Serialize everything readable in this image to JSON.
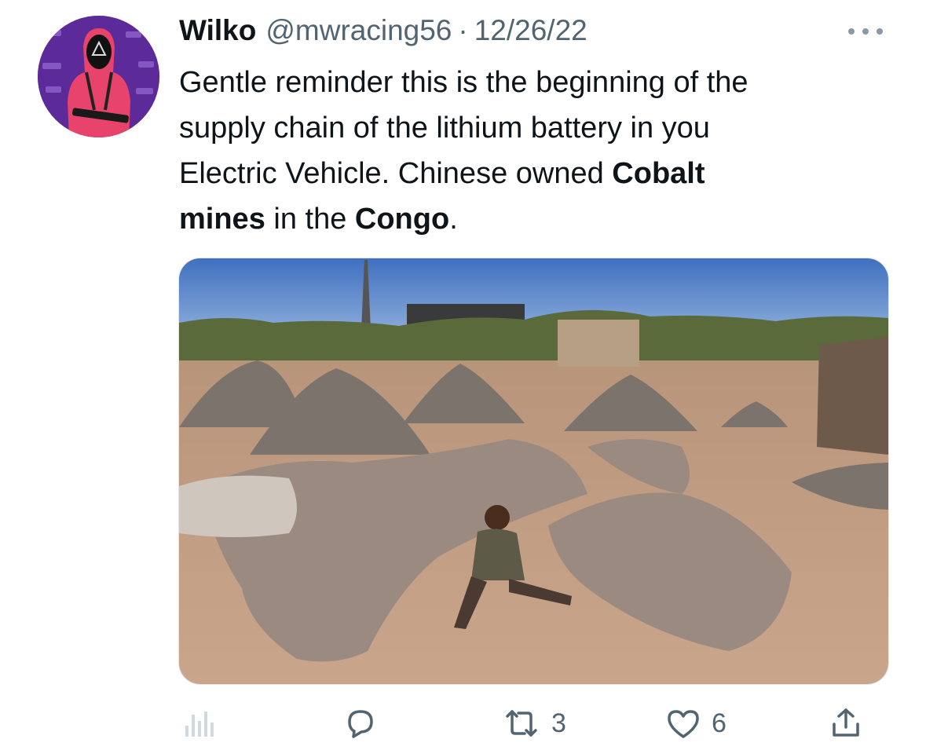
{
  "tweet": {
    "display_name": "Wilko",
    "handle": "@mwracing56",
    "separator": "·",
    "date": "12/26/22",
    "text": {
      "p1": "Gentle reminder this is the beginning of the",
      "p2": "supply chain of the lithium battery in you",
      "p3": "Electric Vehicle. Chinese owned ",
      "b1": "Cobalt",
      "b2": "mines",
      "p4": " in the ",
      "b3": "Congo",
      "p5": "."
    }
  },
  "actions": {
    "retweet_count": "3",
    "like_count": "6"
  },
  "icons": {
    "more": "more-icon",
    "analytics": "analytics-icon",
    "reply": "reply-icon",
    "retweet": "retweet-icon",
    "like": "heart-icon",
    "share": "share-icon"
  },
  "colors": {
    "text": "#0f1419",
    "secondary": "#536471",
    "avatar_bg": "#6b2fa6",
    "hoodie": "#e8436a"
  }
}
